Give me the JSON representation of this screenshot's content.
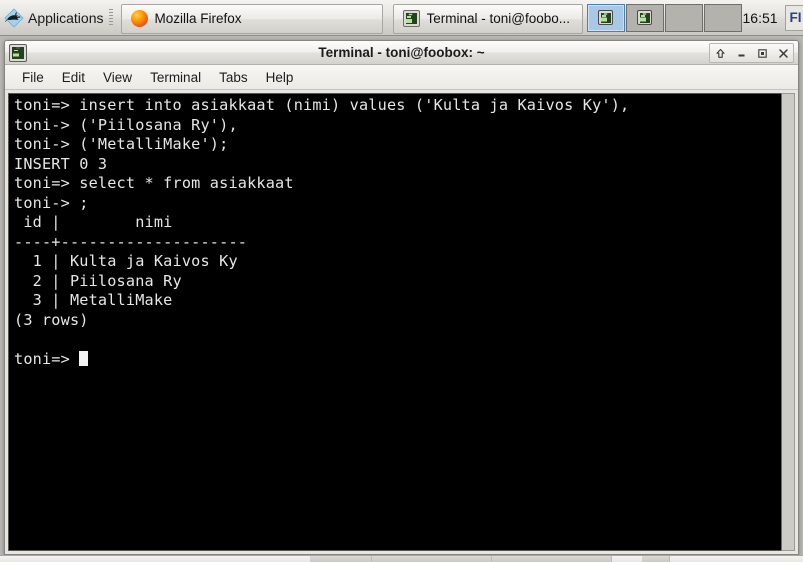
{
  "panel": {
    "applications_label": "Applications",
    "applications_icon": "rodent-icon",
    "tasks": [
      {
        "label": "Mozilla Firefox",
        "icon": "firefox-icon"
      },
      {
        "label": "Terminal - toni@foobo...",
        "icon": "terminal-icon"
      }
    ],
    "workspaces": [
      {
        "index": 1,
        "active": true,
        "has_window": true
      },
      {
        "index": 2,
        "active": false,
        "has_window": true
      },
      {
        "index": 3,
        "active": false,
        "has_window": false
      },
      {
        "index": 4,
        "active": false,
        "has_window": false
      }
    ],
    "clock": "16:51",
    "keyboard_layout": "FI",
    "keyboard_icon": "keyboard-layout-icon",
    "user": "toni"
  },
  "window": {
    "title": "Terminal - toni@foobox: ~",
    "icon": "terminal-icon",
    "controls": [
      {
        "name": "shade-button",
        "glyph": "up-arrow-icon"
      },
      {
        "name": "minimize-button",
        "glyph": "minimize-icon"
      },
      {
        "name": "maximize-button",
        "glyph": "maximize-icon"
      },
      {
        "name": "close-button",
        "glyph": "close-icon"
      }
    ],
    "menus": [
      "File",
      "Edit",
      "View",
      "Terminal",
      "Tabs",
      "Help"
    ]
  },
  "terminal": {
    "prompt_primary": "toni=>",
    "prompt_continuation": "toni->",
    "foreground": "#e6e6e6",
    "background": "#000000",
    "lines": [
      "toni=> insert into asiakkaat (nimi) values ('Kulta ja Kaivos Ky'),",
      "toni-> ('Piilosana Ry'),",
      "toni-> ('MetalliMake');",
      "INSERT 0 3",
      "toni=> select * from asiakkaat",
      "toni-> ;",
      " id |        nimi",
      "----+--------------------",
      "  1 | Kulta ja Kaivos Ky",
      "  2 | Piilosana Ry",
      "  3 | MetalliMake",
      "(3 rows)",
      ""
    ],
    "cursor_line": "toni=> ",
    "table": {
      "columns": [
        "id",
        "nimi"
      ],
      "rows": [
        {
          "id": "1",
          "nimi": "Kulta ja Kaivos Ky"
        },
        {
          "id": "2",
          "nimi": "Piilosana Ry"
        },
        {
          "id": "3",
          "nimi": "MetalliMake"
        }
      ],
      "row_count_text": "(3 rows)"
    },
    "insert_result": "INSERT 0 3"
  }
}
